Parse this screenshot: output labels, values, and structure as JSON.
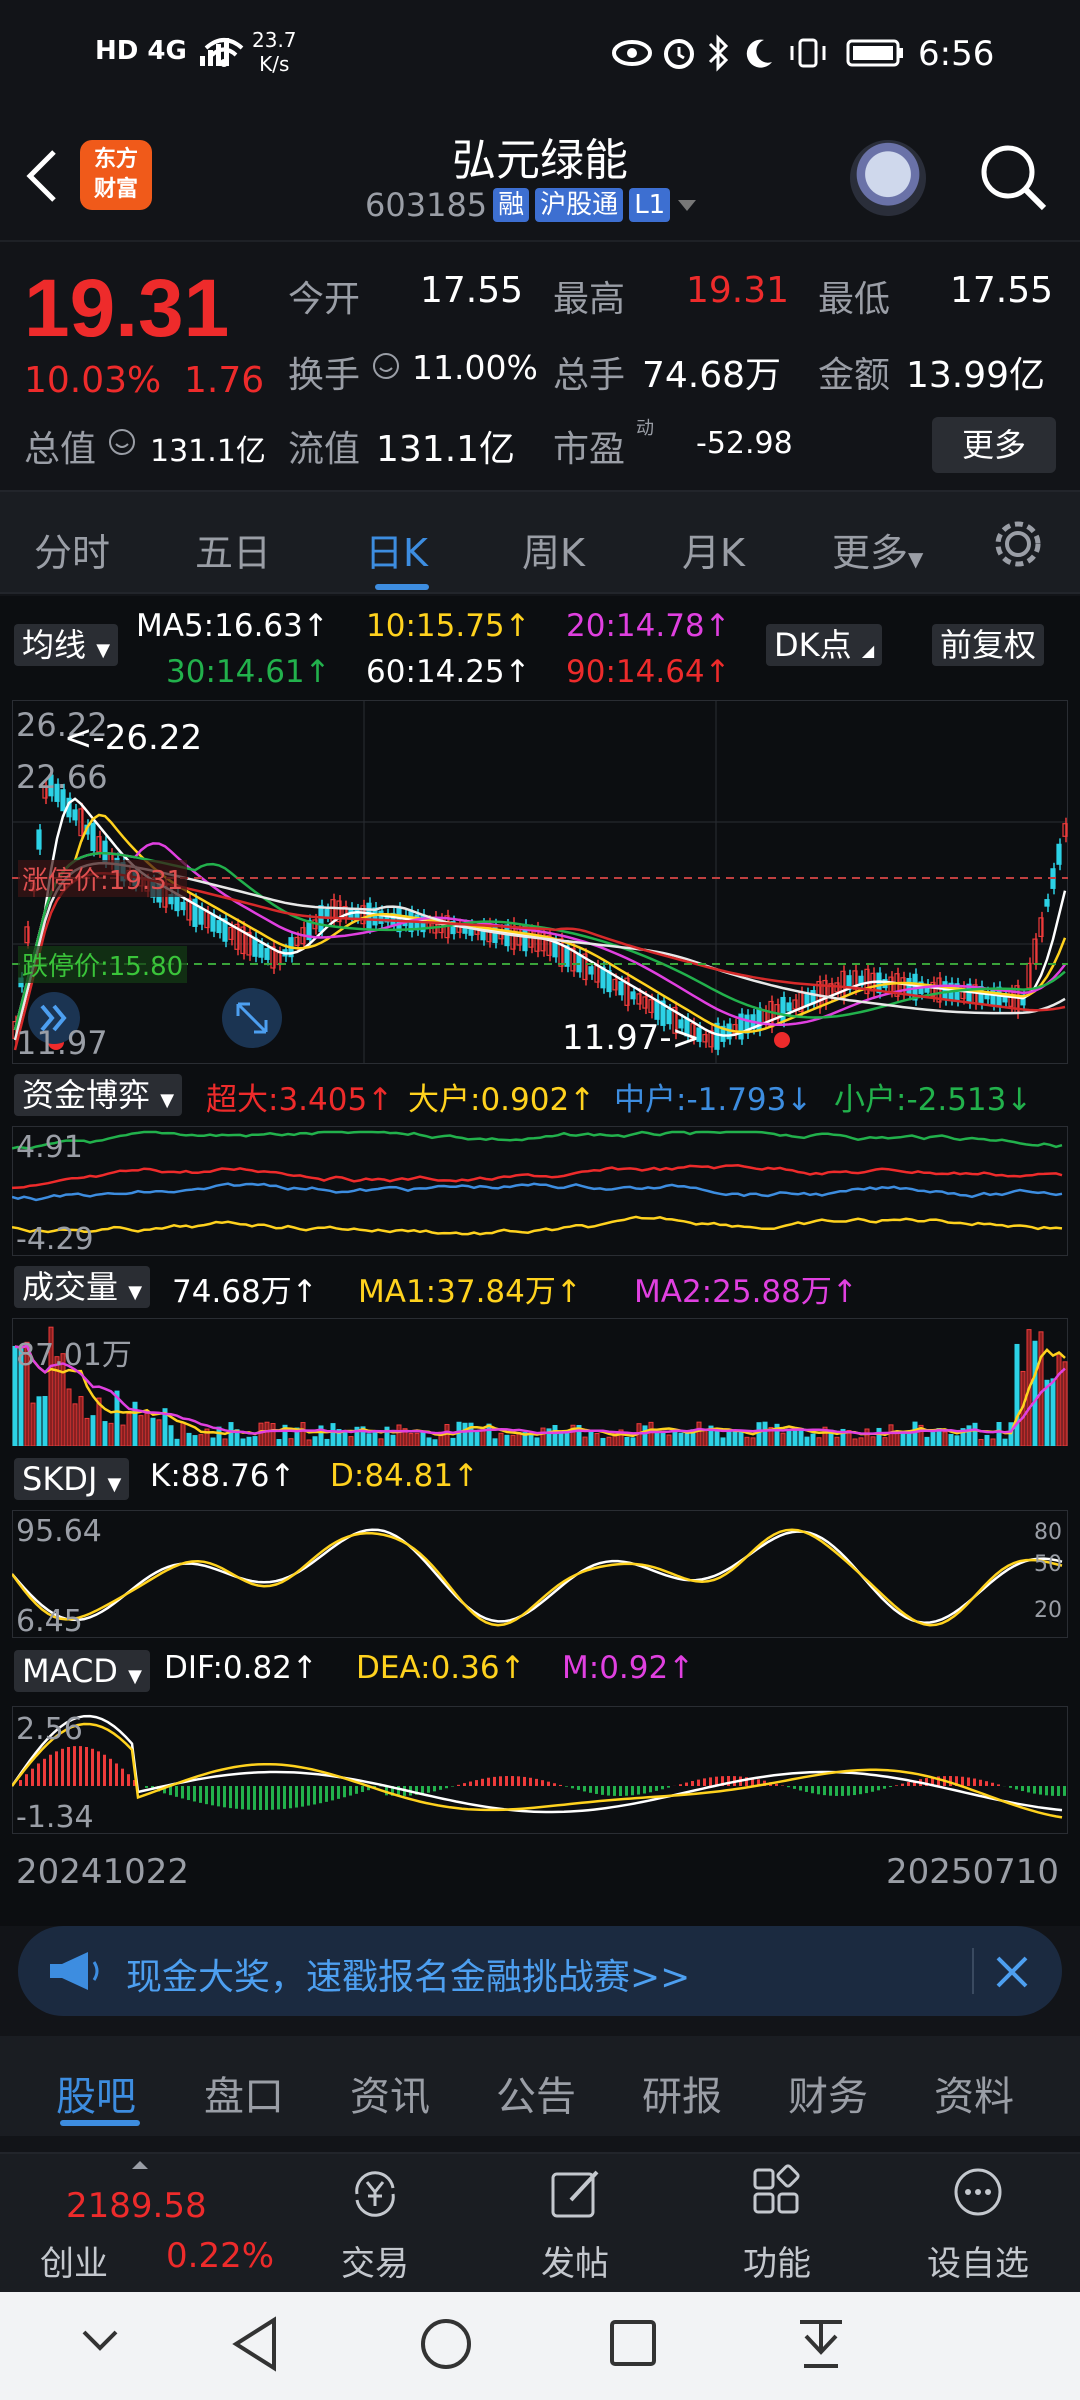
{
  "status_bar": {
    "left_icons": "HD 4G",
    "net_speed_top": "23.7",
    "net_speed_bottom": "K/s",
    "time": "6:56"
  },
  "header": {
    "logo_line1": "东方",
    "logo_line2": "财富",
    "stock_name": "弘元绿能",
    "stock_code": "603185",
    "tag_margin": "融",
    "tag_connect": "沪股通",
    "tag_level": "L1"
  },
  "quote": {
    "price": "19.31",
    "change_pct": "10.03%",
    "change_amt": "1.76",
    "open_label": "今开",
    "open": "17.55",
    "high_label": "最高",
    "high": "19.31",
    "low_label": "最低",
    "low": "17.55",
    "turnover_label": "换手",
    "turnover": "11.00%",
    "volume_label": "总手",
    "volume": "74.68万",
    "amount_label": "金额",
    "amount": "13.99亿",
    "mktcap_label": "总值",
    "mktcap": "131.1亿",
    "float_label": "流值",
    "float": "131.1亿",
    "pe_label": "市盈",
    "pe_sup": "动",
    "pe": "-52.98",
    "more": "更多"
  },
  "period_tabs": [
    "分时",
    "五日",
    "日K",
    "周K",
    "月K",
    "更多"
  ],
  "chart": {
    "ma_selector": "均线",
    "ma5": "MA5:16.63↑",
    "ma10": "10:15.75↑",
    "ma20": "20:14.78↑",
    "ma30": "30:14.61↑",
    "ma60": "60:14.25↑",
    "ma90": "90:14.64↑",
    "dk_button": "DK点",
    "adjust_button": "前复权",
    "kline_max": "26.22",
    "kline_high_marker": "<-26.22",
    "kline_mid": "22.66",
    "kline_low": "11.97",
    "kline_low_marker": "11.97->",
    "limit_up_label": "涨停价:19.31",
    "limit_down_label": "跌停价:15.80",
    "fund_selector": "资金博弈",
    "fund_super": "超大:3.405↑",
    "fund_big": "大户:0.902↑",
    "fund_mid": "中户:-1.793↓",
    "fund_small": "小户:-2.513↓",
    "fund_max": "4.91",
    "fund_min": "-4.29",
    "vol_selector": "成交量",
    "vol_value": "74.68万↑",
    "vol_ma1": "MA1:37.84万↑",
    "vol_ma2": "MA2:25.88万↑",
    "vol_max": "87.01万",
    "skdj_selector": "SKDJ",
    "skdj_k": "K:88.76↑",
    "skdj_d": "D:84.81↑",
    "skdj_max": "95.64",
    "skdj_min": "6.45",
    "skdj_80": "80",
    "skdj_50": "50",
    "skdj_20": "20",
    "macd_selector": "MACD",
    "macd_dif": "DIF:0.82↑",
    "macd_dea": "DEA:0.36↑",
    "macd_m": "M:0.92↑",
    "macd_max": "2.56",
    "macd_min": "-1.34",
    "date_start": "20241022",
    "date_end": "20250710"
  },
  "banner": {
    "text": "现金大奖，速戳报名金融挑战赛>>"
  },
  "bottom_tabs": [
    "股吧",
    "盘口",
    "资讯",
    "公告",
    "研报",
    "财务",
    "资料"
  ],
  "toolbar": {
    "index_value": "2189.58",
    "index_name": "创业",
    "index_change": "0.22%",
    "trade": "交易",
    "post": "发帖",
    "functions": "功能",
    "watchlist": "设自选"
  }
}
